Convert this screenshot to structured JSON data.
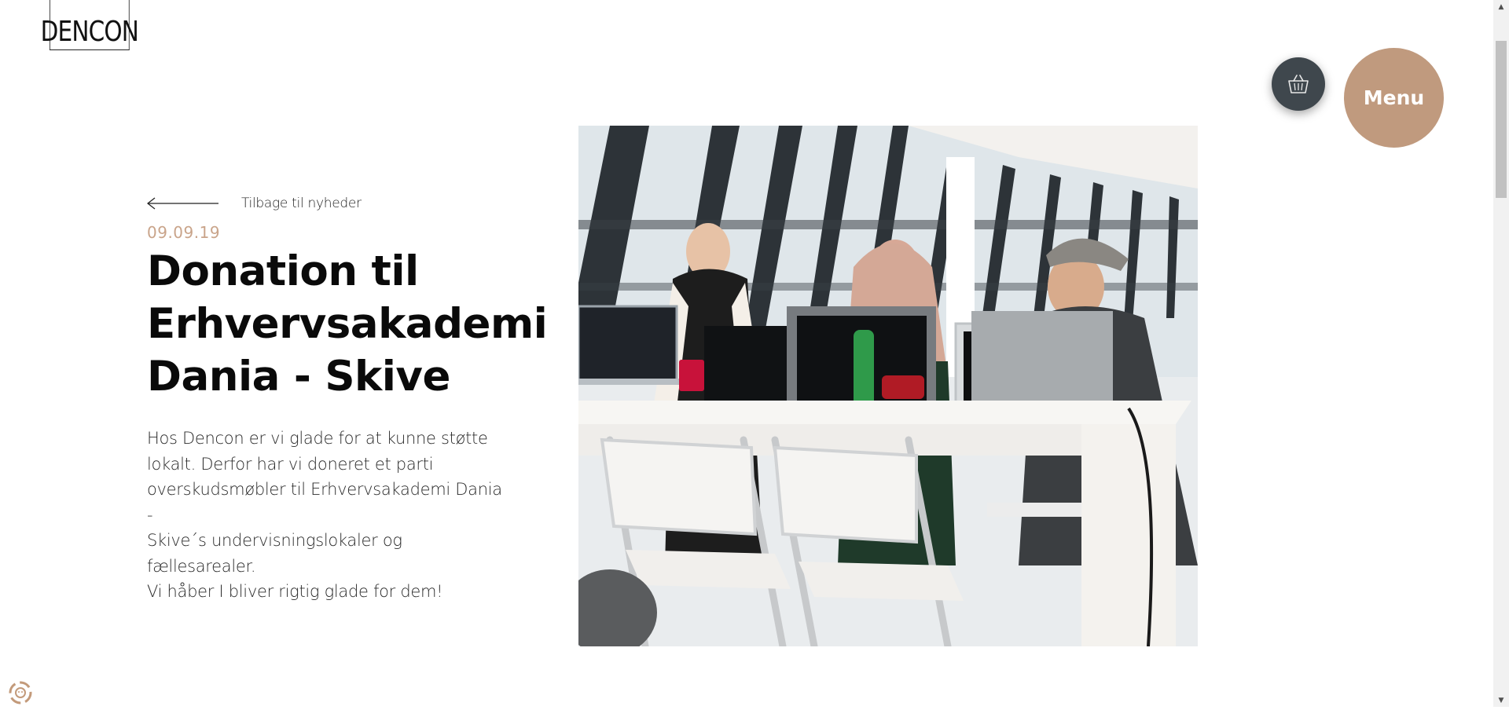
{
  "header": {
    "logo_text": "DENCON",
    "cart_icon": "basket-icon",
    "menu_label": "Menu"
  },
  "article": {
    "back_link_label": "Tilbage til nyheder",
    "date": "09.09.19",
    "title_lines": [
      "Donation til",
      "Erhvervsakademi",
      "Dania - Skive"
    ],
    "body_lines": [
      "Hos Dencon er vi glade for at kunne støtte",
      "lokalt. Derfor har vi doneret et parti",
      "overskudsmøbler til Erhvervsakademi Dania -",
      "Skive´s undervisningslokaler og fællesarealer.",
      "Vi håber I bliver rigtig glade for dem!"
    ]
  },
  "colors": {
    "accent": "#c09a7e",
    "date": "#c9a48a",
    "cart_bg": "#3f474d"
  },
  "cookie_icon": "cookie-settings-icon"
}
